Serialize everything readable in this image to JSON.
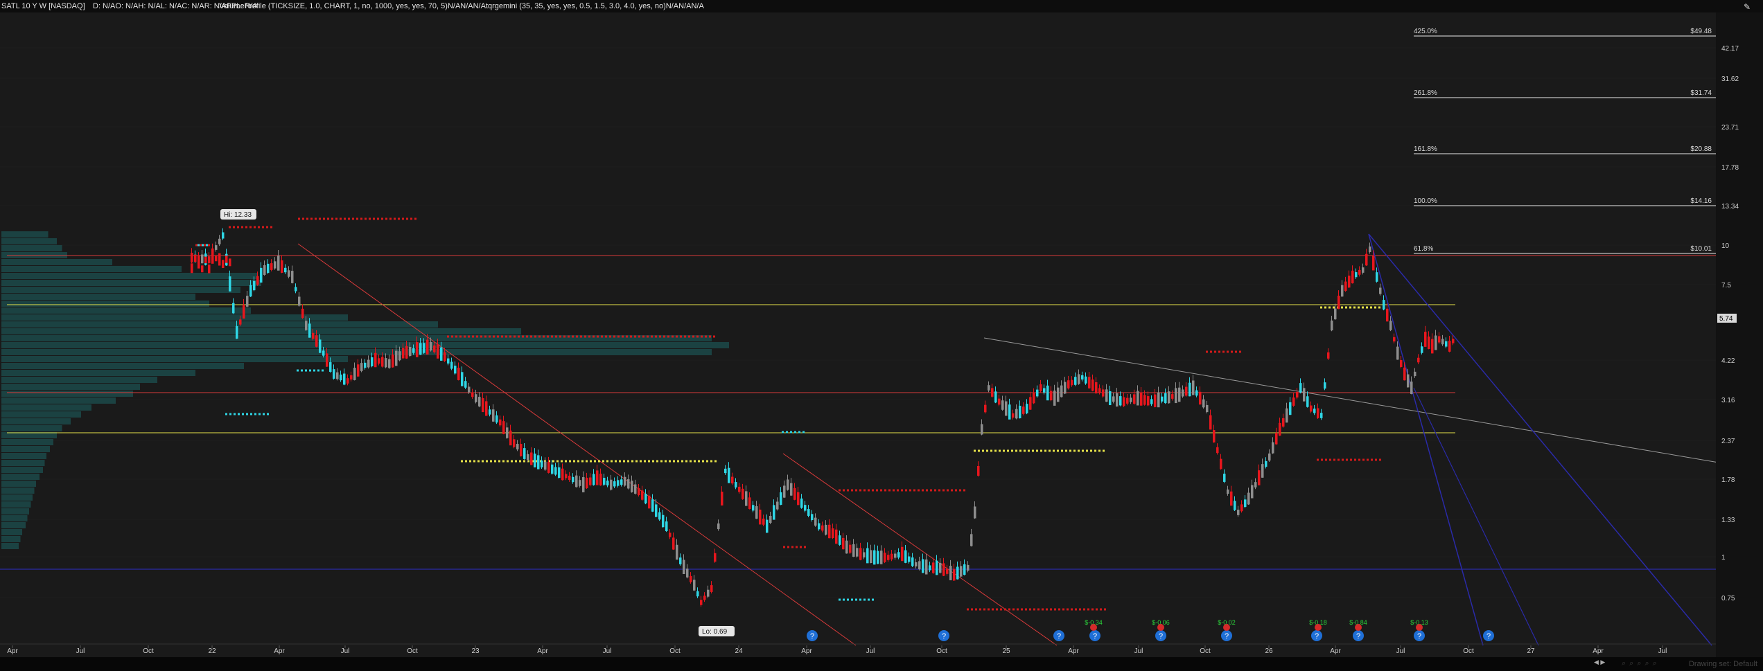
{
  "header": {
    "symbol": "SATL 10 Y W [NASDAQ]",
    "quote": "D: N/AO: N/AH: N/AL: N/AC: N/AR: N/AFPL: N/A",
    "study": "VolumeProfile (TICKSIZE, 1.0, CHART, 1, no, 1000, yes, yes, 70, 5)N/AN/AN/Atqrgemini (35, 35, yes, yes, 0.5, 1.5, 3.0, 4.0, yes, no)N/AN/AN/A"
  },
  "footer": {
    "drawing_set": "Drawing set: Default"
  },
  "price_axis": {
    "labels": [
      "42.17",
      "31.62",
      "23.71",
      "17.78",
      "13.34",
      "10",
      "7.5",
      "4.22",
      "3.16",
      "2.37",
      "1.78",
      "1.33",
      "1",
      "0.75"
    ]
  },
  "last_price": "5.74",
  "fib_levels": [
    {
      "pct": "425.0%",
      "price": "$49.48"
    },
    {
      "pct": "261.8%",
      "price": "$31.74"
    },
    {
      "pct": "161.8%",
      "price": "$20.88"
    },
    {
      "pct": "100.0%",
      "price": "$14.16"
    },
    {
      "pct": "61.8%",
      "price": "$10.01"
    }
  ],
  "time_axis": [
    "Apr",
    "Jul",
    "Oct",
    "22",
    "Apr",
    "Jul",
    "Oct",
    "23",
    "Apr",
    "Jul",
    "Oct",
    "24",
    "Apr",
    "Jul",
    "Oct",
    "25",
    "Apr",
    "Jul",
    "Oct",
    "26",
    "Apr",
    "Jul",
    "Oct",
    "27",
    "Apr",
    "Jul"
  ],
  "bubbles": {
    "hi": "Hi: 12.33",
    "lo": "Lo: 0.69"
  },
  "earnings": [
    {
      "value": ""
    },
    {
      "value": ""
    },
    {
      "value": "$-0.34"
    },
    {
      "value": "$-0.06"
    },
    {
      "value": "$-0.02"
    },
    {
      "value": "$-0.18"
    },
    {
      "value": "$-0.84"
    },
    {
      "value": "$-0.13"
    }
  ],
  "colors": {
    "up": "#2fd7e6",
    "down": "#e8161d",
    "neutral": "#8e8e8e",
    "fib": "#e9e9e9",
    "yellow": "#e6e24a",
    "trend_red": "#d83a3a",
    "trend_blue": "#2a2aa8"
  }
}
